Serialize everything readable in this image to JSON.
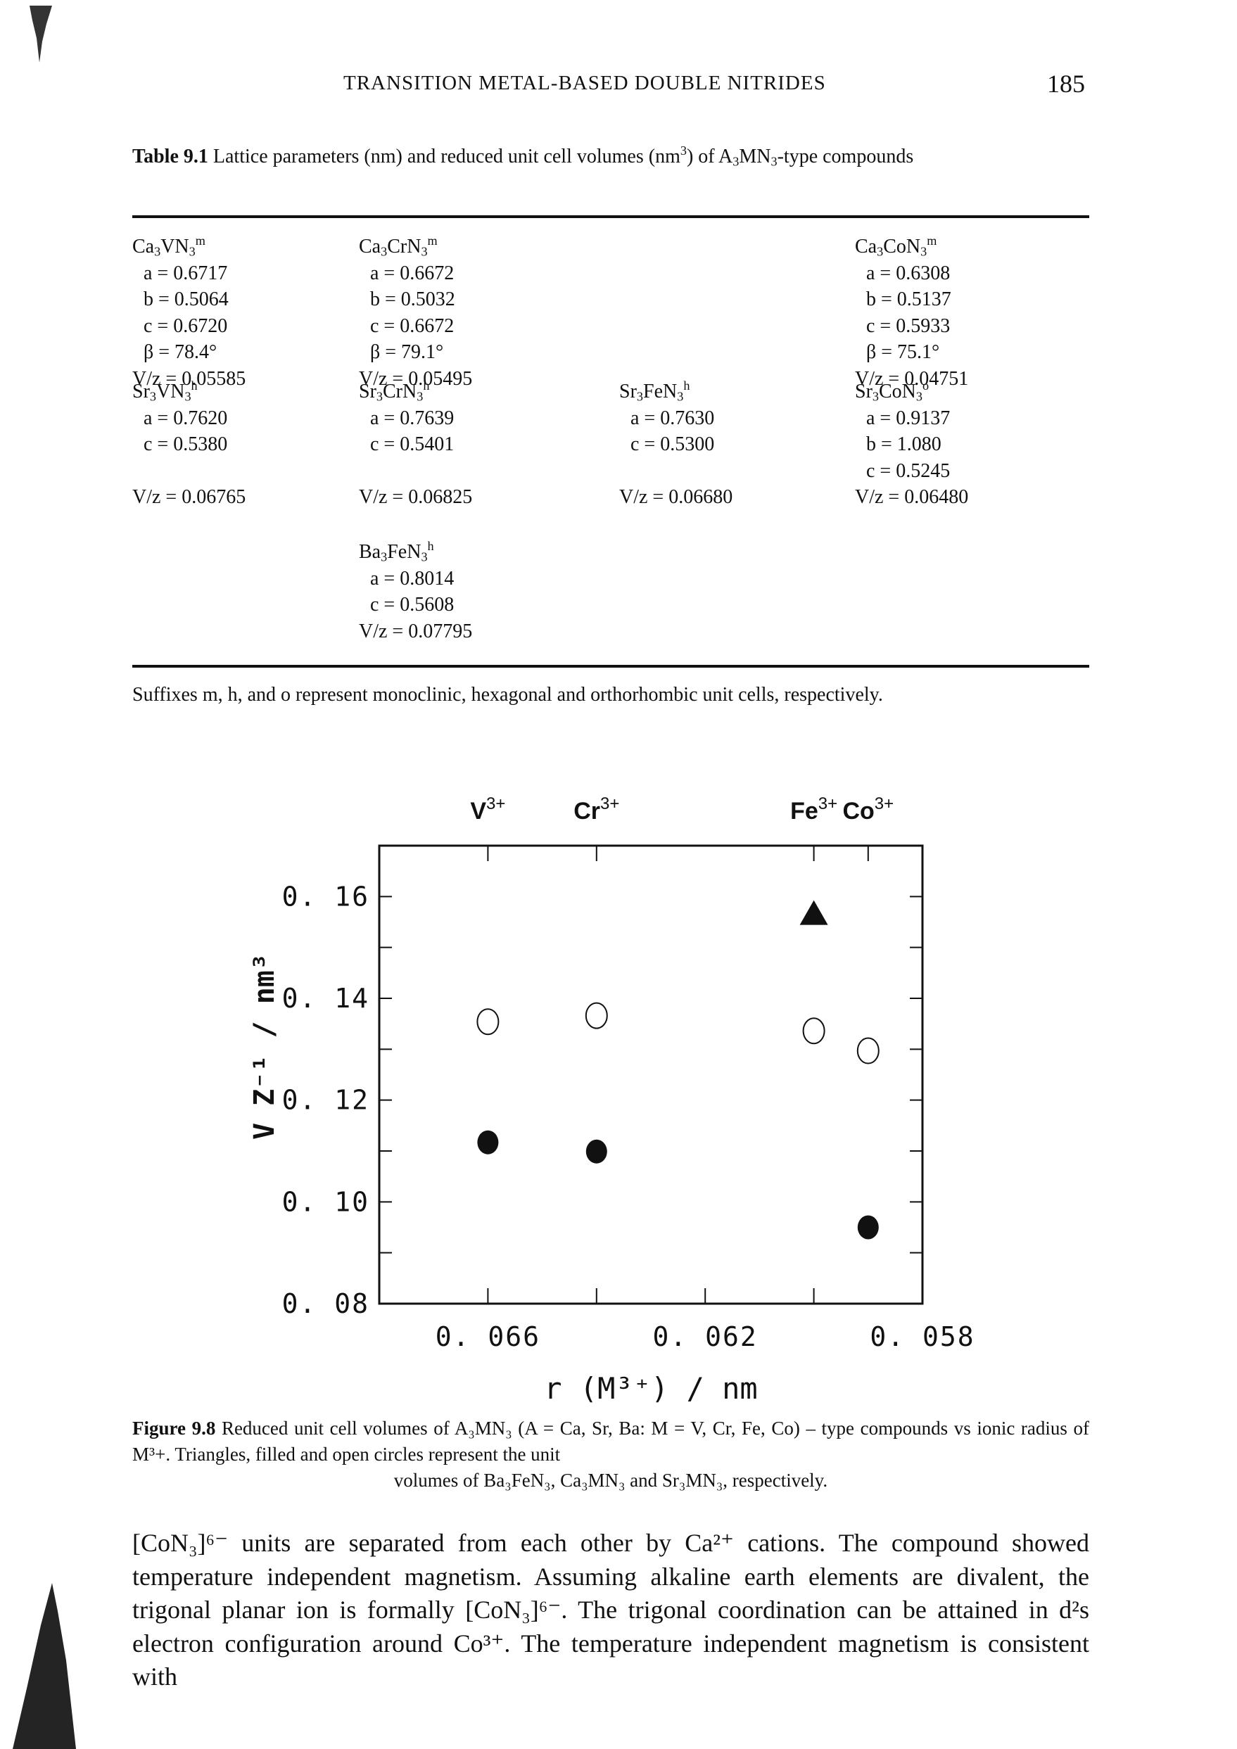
{
  "header": {
    "running_title": "Transition metal-based double nitrides",
    "page_number": "185"
  },
  "table": {
    "label": "Table 9.1",
    "caption_pre": " Lattice parameters (nm) and reduced unit cell volumes (nm",
    "caption_sup": "3",
    "caption_mid": ") of A",
    "caption_sub1": "3",
    "caption_mid2": "MN",
    "caption_sub2": "3",
    "caption_post": "-type compounds",
    "compounds": [
      {
        "A": "Ca",
        "M": "V",
        "suffix": "m",
        "lines": [
          "a = 0.6717",
          "b = 0.5064",
          "c = 0.6720",
          "β = 78.4°"
        ],
        "vz": "V/z = 0.05585"
      },
      {
        "A": "Ca",
        "M": "Cr",
        "suffix": "m",
        "lines": [
          "a = 0.6672",
          "b = 0.5032",
          "c = 0.6672",
          "β = 79.1°"
        ],
        "vz": "V/z = 0.05495"
      },
      {
        "A": "Ca",
        "M": "Co",
        "suffix": "m",
        "lines": [
          "a = 0.6308",
          "b = 0.5137",
          "c = 0.5933",
          "β = 75.1°"
        ],
        "vz": "V/z = 0.04751"
      },
      {
        "A": "Sr",
        "M": "V",
        "suffix": "h",
        "lines": [
          "a = 0.7620",
          "c = 0.5380"
        ],
        "vz": "V/z = 0.06765"
      },
      {
        "A": "Sr",
        "M": "Cr",
        "suffix": "h",
        "lines": [
          "a = 0.7639",
          "c = 0.5401"
        ],
        "vz": "V/z = 0.06825"
      },
      {
        "A": "Sr",
        "M": "Fe",
        "suffix": "h",
        "lines": [
          "a = 0.7630",
          "c = 0.5300"
        ],
        "vz": "V/z = 0.06680"
      },
      {
        "A": "Sr",
        "M": "Co",
        "suffix": "o",
        "lines": [
          "a = 0.9137",
          "b = 1.080",
          "c = 0.5245"
        ],
        "vz": "V/z = 0.06480"
      },
      {
        "A": "Ba",
        "M": "Fe",
        "suffix": "h",
        "lines": [
          "a = 0.8014",
          "c = 0.5608"
        ],
        "vz": "V/z = 0.07795"
      }
    ],
    "footnote": "Suffixes m, h, and o represent monoclinic, hexagonal and orthorhombic unit cells, respectively."
  },
  "figure": {
    "label": "Figure 9.8",
    "caption_line1": " Reduced unit cell volumes of A₃MN₃ (A = Ca, Sr, Ba: M = V, Cr, Fe, Co) – type compounds vs ionic radius of M³+. Triangles, filled and open circles represent the unit",
    "caption_line2": "volumes of Ba₃FeN₃, Ca₃MN₃ and Sr₃MN₃, respectively."
  },
  "chart_data": {
    "type": "scatter",
    "title": "",
    "xlabel": "r (M³⁺) / nm",
    "ylabel": "V Z⁻¹ / nm³",
    "xlim": [
      0.068,
      0.058
    ],
    "x_reversed": true,
    "ylim": [
      0.08,
      0.17
    ],
    "x_ticks": [
      0.066,
      0.064,
      0.062,
      0.06
    ],
    "x_tick_labels": [
      {
        "value": 0.066,
        "label": "0.066"
      },
      {
        "value": 0.062,
        "label": "0.062"
      },
      {
        "value": 0.058,
        "label": "0.058"
      }
    ],
    "y_ticks": [
      0.09,
      0.1,
      0.11,
      0.12,
      0.13,
      0.14,
      0.15,
      0.16
    ],
    "y_tick_labels": [
      {
        "value": 0.16,
        "label": "0.16"
      },
      {
        "value": 0.14,
        "label": "0.14"
      },
      {
        "value": 0.12,
        "label": "0.12"
      },
      {
        "value": 0.1,
        "label": "0.10"
      },
      {
        "value": 0.08,
        "label": "0.08"
      }
    ],
    "top_ions": [
      {
        "ion": "V",
        "charge": "3+",
        "r": 0.066
      },
      {
        "ion": "Cr",
        "charge": "3+",
        "r": 0.064
      },
      {
        "ion": "Fe",
        "charge": "3+",
        "r": 0.06
      },
      {
        "ion": "Co",
        "charge": "3+",
        "r": 0.059
      }
    ],
    "grid": false,
    "series": [
      {
        "name": "Ba3FeN3",
        "marker": "filled-triangle",
        "points": [
          {
            "x": 0.06,
            "y": 0.1565
          }
        ]
      },
      {
        "name": "Ca3MN3",
        "marker": "filled-circle",
        "points": [
          {
            "x": 0.066,
            "y": 0.1117
          },
          {
            "x": 0.064,
            "y": 0.1099
          },
          {
            "x": 0.059,
            "y": 0.095
          }
        ]
      },
      {
        "name": "Sr3MN3",
        "marker": "open-circle",
        "points": [
          {
            "x": 0.066,
            "y": 0.1354
          },
          {
            "x": 0.064,
            "y": 0.1366
          },
          {
            "x": 0.06,
            "y": 0.1336
          },
          {
            "x": 0.059,
            "y": 0.1297
          }
        ]
      }
    ]
  },
  "body": {
    "paragraph": "[CoN₃]⁶⁻ units are separated from each other by Ca²⁺ cations. The compound showed temperature independent magnetism. Assuming alkaline earth elements are divalent, the trigonal planar ion is formally [CoN₃]⁶⁻. The trigonal coordination can be attained in d²s electron configuration around Co³⁺. The temperature independent magnetism is consistent with"
  }
}
